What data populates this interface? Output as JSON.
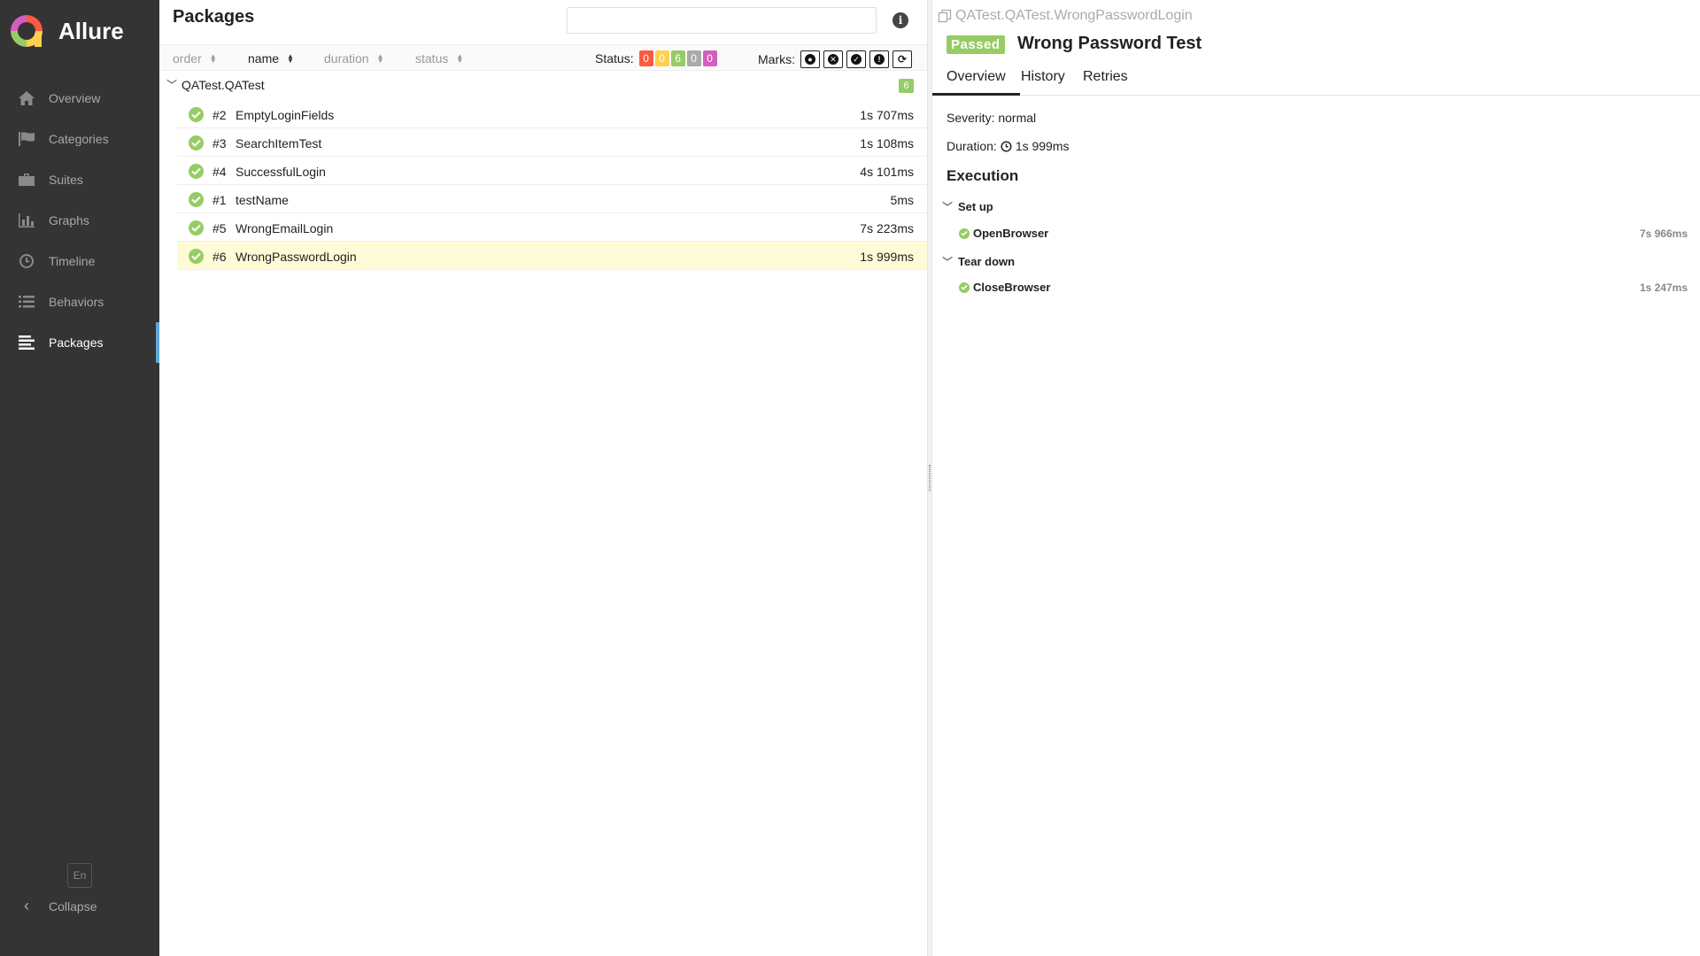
{
  "app": {
    "name": "Allure"
  },
  "sidebar": {
    "items": [
      {
        "label": "Overview",
        "icon": "home-icon"
      },
      {
        "label": "Categories",
        "icon": "flag-icon"
      },
      {
        "label": "Suites",
        "icon": "briefcase-icon"
      },
      {
        "label": "Graphs",
        "icon": "bar-chart-icon"
      },
      {
        "label": "Timeline",
        "icon": "clock-icon"
      },
      {
        "label": "Behaviors",
        "icon": "list-icon"
      },
      {
        "label": "Packages",
        "icon": "align-left-icon",
        "active": true
      }
    ],
    "language": "En",
    "collapse_label": "Collapse"
  },
  "packages": {
    "title": "Packages",
    "search": {
      "value": "",
      "placeholder": ""
    },
    "sort": {
      "order": "order",
      "name": "name",
      "duration": "duration",
      "status": "status"
    },
    "status_filter": {
      "label": "Status:",
      "counts": [
        {
          "status": "failed",
          "value": "0",
          "color": "#fd5a3e"
        },
        {
          "status": "broken",
          "value": "0",
          "color": "#ffd050"
        },
        {
          "status": "passed",
          "value": "6",
          "color": "#97cc64"
        },
        {
          "status": "skipped",
          "value": "0",
          "color": "#aaaaaa"
        },
        {
          "status": "unknown",
          "value": "0",
          "color": "#d35ebe"
        }
      ]
    },
    "marks_filter": {
      "label": "Marks:",
      "marks": [
        "flaky-icon",
        "new-failed-icon",
        "new-passed-icon",
        "new-broken-icon",
        "retries-icon"
      ]
    },
    "group": {
      "name": "QATest.QATest",
      "count": "6"
    },
    "tests": [
      {
        "num": "#2",
        "name": "EmptyLoginFields",
        "duration": "1s 707ms"
      },
      {
        "num": "#3",
        "name": "SearchItemTest",
        "duration": "1s 108ms"
      },
      {
        "num": "#4",
        "name": "SuccessfulLogin",
        "duration": "4s 101ms"
      },
      {
        "num": "#1",
        "name": "testName",
        "duration": "5ms"
      },
      {
        "num": "#5",
        "name": "WrongEmailLogin",
        "duration": "7s 223ms"
      },
      {
        "num": "#6",
        "name": "WrongPasswordLogin",
        "duration": "1s 999ms",
        "selected": true
      }
    ]
  },
  "detail": {
    "path": "QATest.QATest.WrongPasswordLogin",
    "status": "Passed",
    "title": "Wrong Password Test",
    "tabs": [
      "Overview",
      "History",
      "Retries"
    ],
    "severity_label": "Severity:",
    "severity_value": "normal",
    "duration_label": "Duration:",
    "duration_value": "1s 999ms",
    "execution_heading": "Execution",
    "setup": {
      "label": "Set up",
      "step": "OpenBrowser",
      "duration": "7s 966ms"
    },
    "teardown": {
      "label": "Tear down",
      "step": "CloseBrowser",
      "duration": "1s 247ms"
    }
  },
  "colors": {
    "sidebar_bg": "#343434",
    "passed": "#97cc64",
    "selected_row": "#fffbd6",
    "accent": "#5fa7d6"
  }
}
